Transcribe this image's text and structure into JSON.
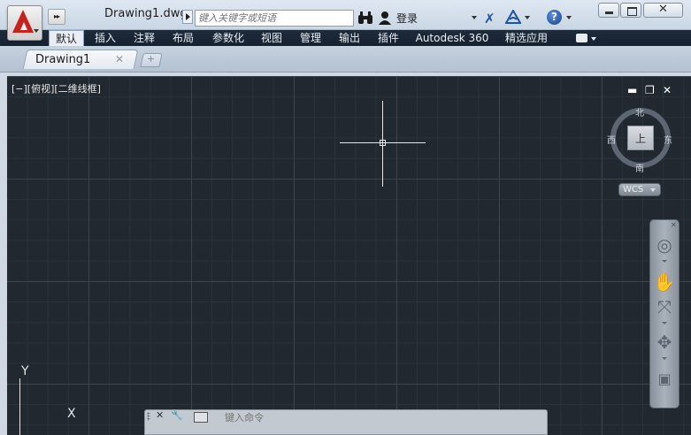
{
  "titlebar": {
    "doc_title": "Drawing1.dwg",
    "search_placeholder": "键入关键字或短语",
    "login_label": "登录",
    "help_label": "?",
    "close_label": "✕"
  },
  "ribbon": {
    "tabs": [
      {
        "label": "默认",
        "active": true
      },
      {
        "label": "插入"
      },
      {
        "label": "注释"
      },
      {
        "label": "布局"
      },
      {
        "label": "参数化"
      },
      {
        "label": "视图"
      },
      {
        "label": "管理"
      },
      {
        "label": "输出"
      },
      {
        "label": "插件"
      },
      {
        "label": "Autodesk 360"
      },
      {
        "label": "精选应用"
      }
    ]
  },
  "file_tabs": {
    "active_label": "Drawing1",
    "close_glyph": "✕",
    "new_glyph": "+"
  },
  "viewport": {
    "view_label": "[−][俯视][二维线框]",
    "minimize_glyph": "▬",
    "restore_glyph": "❐",
    "close_glyph": "✕"
  },
  "viewcube": {
    "north": "北",
    "south": "南",
    "east": "东",
    "west": "西",
    "face_label": "上",
    "wcs_label": "WCS"
  },
  "navbar": {
    "close_glyph": "✕",
    "icons": [
      "steering-wheel-icon",
      "pan-icon",
      "zoom-icon",
      "orbit-icon",
      "showmotion-icon"
    ]
  },
  "ucs": {
    "y_label": "Y",
    "x_label": "X"
  },
  "command_line": {
    "placeholder": "键入命令",
    "close_glyph": "✕",
    "wrench_glyph": "🔧"
  },
  "colors": {
    "background": "#212830",
    "ribbon": "#1f2b3b",
    "logo": "#c8221e"
  }
}
